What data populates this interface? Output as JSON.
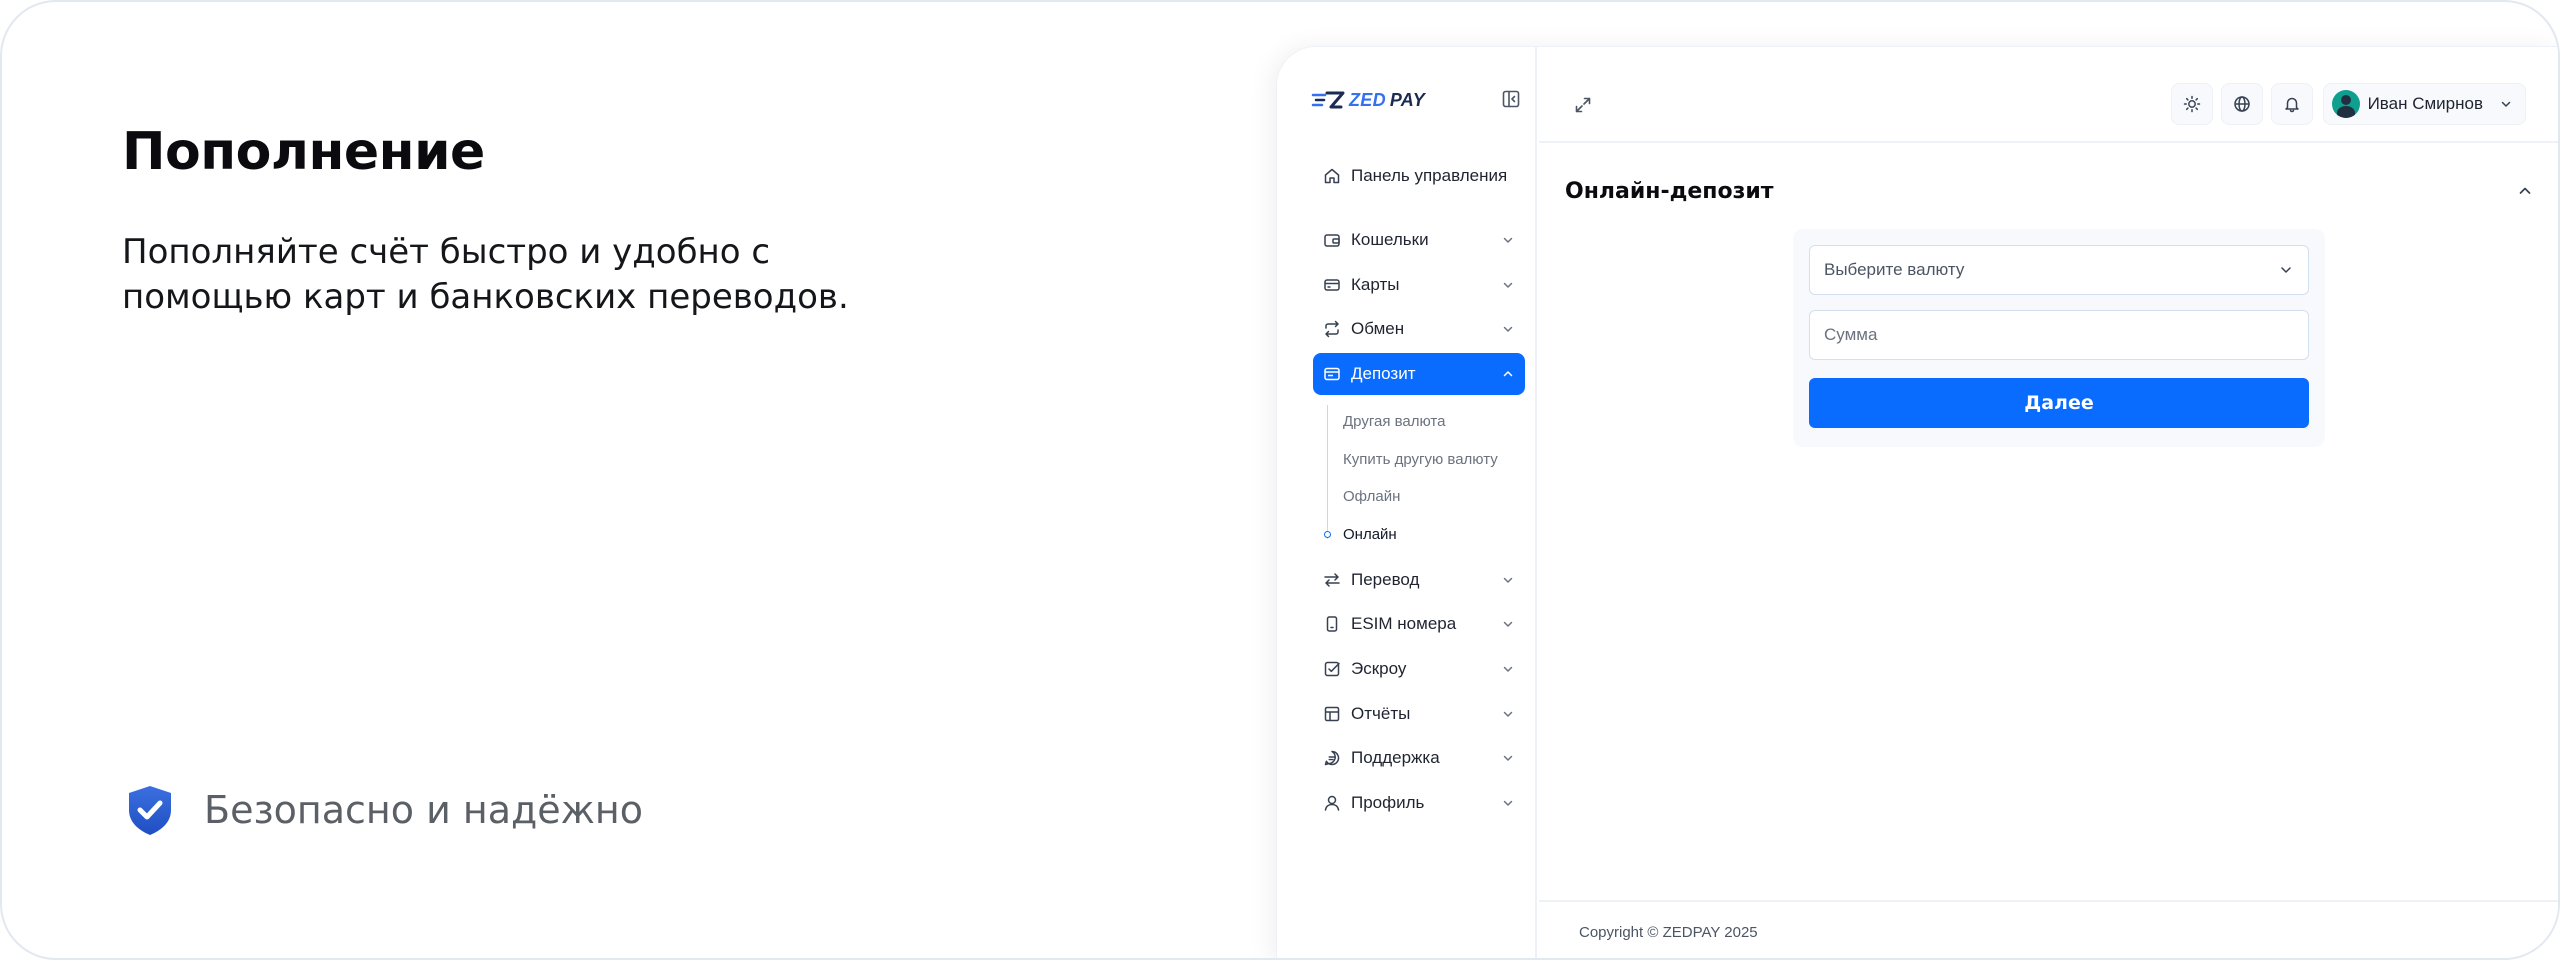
{
  "promo": {
    "title": "Пополнение",
    "description": "Пополняйте счёт быстро и удобно с помощью карт и банковских переводов.",
    "feature": "Безопасно и надёжно",
    "feature_icon": "shield-check-icon"
  },
  "brand": {
    "logo_prefix": "ZED",
    "logo_suffix": "PAY",
    "accent": "#0a6cff"
  },
  "sidebar": {
    "items": [
      {
        "label": "Панель управления",
        "icon": "home-icon"
      },
      {
        "label": "Кошельки",
        "icon": "wallet-icon"
      },
      {
        "label": "Карты",
        "icon": "card-icon"
      },
      {
        "label": "Обмен",
        "icon": "exchange-icon"
      },
      {
        "label": "Депозит",
        "icon": "deposit-icon"
      },
      {
        "label": "Перевод",
        "icon": "transfer-icon"
      },
      {
        "label": "ESIM номера",
        "icon": "sim-icon"
      },
      {
        "label": "Эскроу",
        "icon": "checkbox-icon"
      },
      {
        "label": "Отчёты",
        "icon": "report-icon"
      },
      {
        "label": "Поддержка",
        "icon": "chat-icon"
      },
      {
        "label": "Профиль",
        "icon": "user-icon"
      }
    ],
    "deposit_submenu": [
      {
        "label": "Другая валюта"
      },
      {
        "label": "Купить другую валюту"
      },
      {
        "label": "Офлайн"
      },
      {
        "label": "Онлайн"
      }
    ],
    "active_item": "Депозит",
    "current_subitem": "Онлайн"
  },
  "header": {
    "user_name": "Иван Смирнов"
  },
  "main": {
    "title": "Онлайн-депозит",
    "currency_placeholder": "Выберите валюту",
    "amount_placeholder": "Сумма",
    "submit_label": "Далее"
  },
  "footer": {
    "copyright": "Copyright © ZEDPAY 2025"
  }
}
